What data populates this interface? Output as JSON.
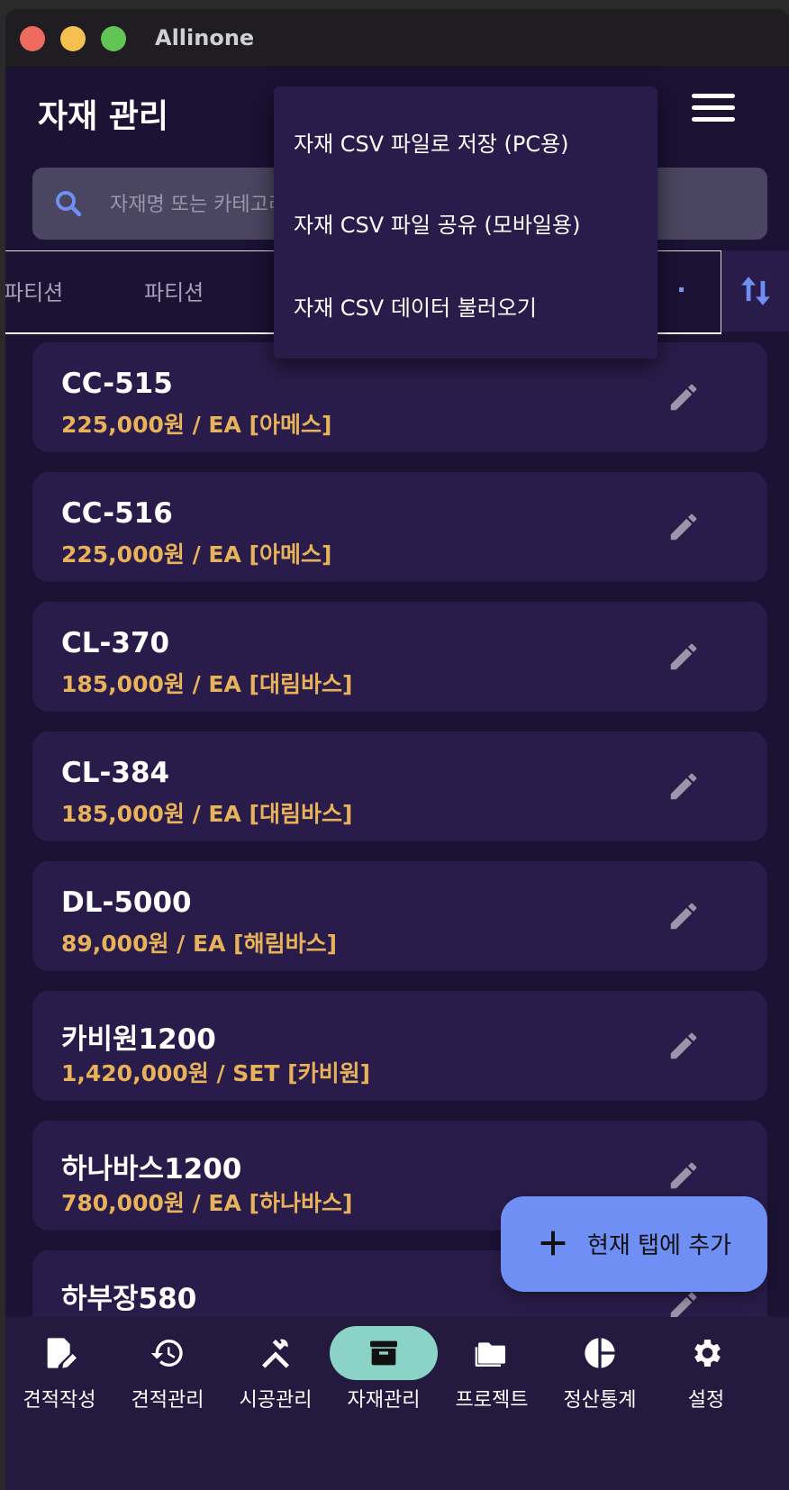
{
  "window": {
    "title": "Allinone"
  },
  "header": {
    "title": "자재 관리"
  },
  "search": {
    "placeholder": "자재명 또는 카테고리로 검색"
  },
  "tabs": [
    {
      "label": "파티션"
    },
    {
      "label": "파티션"
    }
  ],
  "menu": {
    "items": [
      {
        "label": "자재 CSV 파일로 저장 (PC용)"
      },
      {
        "label": "자재 CSV 파일 공유 (모바일용)"
      },
      {
        "label": "자재 CSV 데이터 불러오기"
      }
    ]
  },
  "materials": [
    {
      "name": "CC-515",
      "detail": "225,000원 / EA [아메스]"
    },
    {
      "name": "CC-516",
      "detail": "225,000원 / EA [아메스]"
    },
    {
      "name": "CL-370",
      "detail": "185,000원 / EA [대림바스]"
    },
    {
      "name": "CL-384",
      "detail": "185,000원 / EA [대림바스]"
    },
    {
      "name": "DL-5000",
      "detail": "89,000원 / EA [해림바스]"
    },
    {
      "name": "카비원1200",
      "detail": "1,420,000원 / SET [카비원]"
    },
    {
      "name": "하나바스1200",
      "detail": "780,000원 / EA [하나바스]"
    },
    {
      "name": "하부장580",
      "detail": ""
    }
  ],
  "fab": {
    "label": "현재 탭에 추가"
  },
  "bottom_nav": {
    "items": [
      {
        "label": "견적작성",
        "icon": "edit-document-icon"
      },
      {
        "label": "견적관리",
        "icon": "history-icon"
      },
      {
        "label": "시공관리",
        "icon": "tools-icon"
      },
      {
        "label": "자재관리",
        "icon": "archive-icon",
        "active": true
      },
      {
        "label": "프로젝트",
        "icon": "folder-icon"
      },
      {
        "label": "정산통계",
        "icon": "pie-chart-icon"
      },
      {
        "label": "설정",
        "icon": "gear-icon"
      }
    ]
  },
  "colors": {
    "background": "#1b1234",
    "card": "#2a1c4a",
    "price": "#e8b25a",
    "accent": "#6f8ff5",
    "active_nav": "#8ad3c6"
  }
}
